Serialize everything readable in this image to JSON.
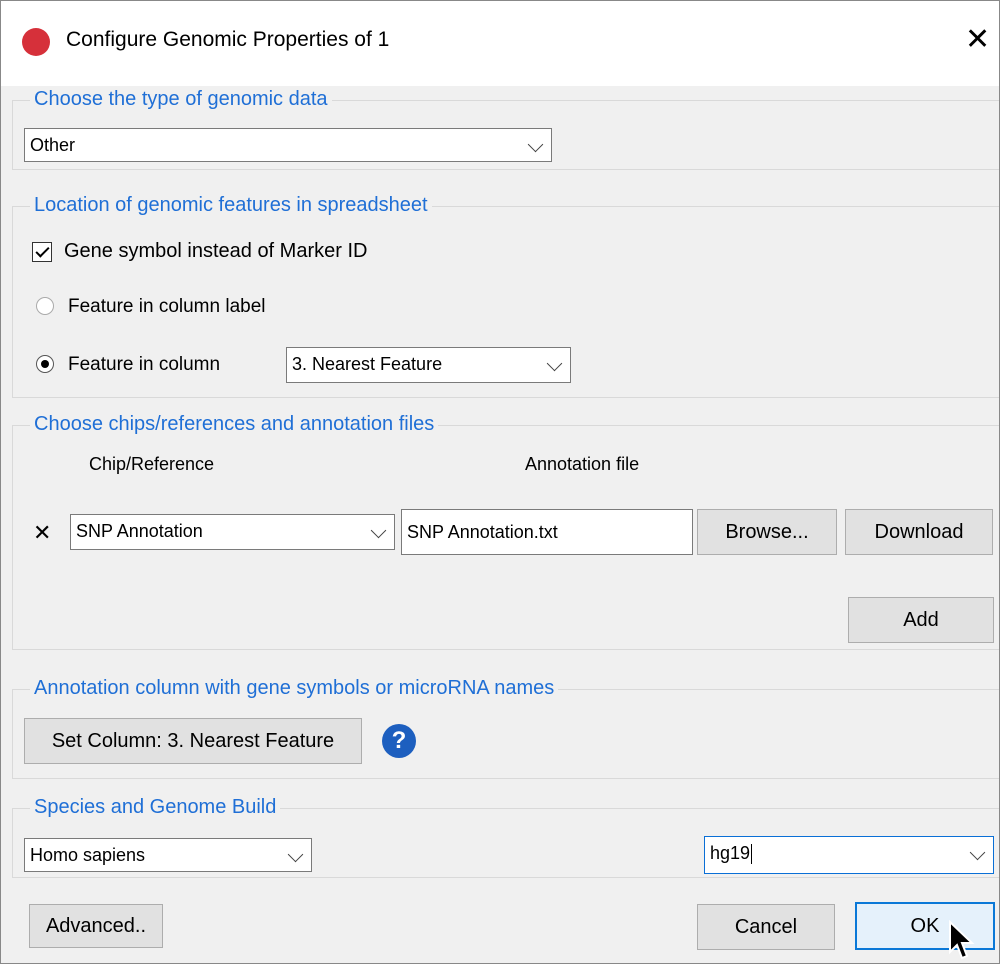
{
  "window": {
    "title": "Configure Genomic Properties of 1",
    "close_glyph": "✕"
  },
  "genomic_type": {
    "legend": "Choose the type of genomic data",
    "selected": "Other"
  },
  "location": {
    "legend": "Location of genomic features in spreadsheet",
    "gene_symbol_label": "Gene symbol instead of Marker ID",
    "gene_symbol_checked": true,
    "feature_label_option": "Feature in column label",
    "feature_column_option": "Feature in column",
    "feature_column_selected": "3. Nearest Feature"
  },
  "chips": {
    "legend": "Choose chips/references and annotation files",
    "col_chip": "Chip/Reference",
    "col_annotation": "Annotation file",
    "remove_glyph": "✕",
    "chip_selected": "SNP Annotation",
    "annotation_file": "SNP Annotation.txt",
    "browse_label": "Browse...",
    "download_label": "Download",
    "add_label": "Add"
  },
  "annotation_column": {
    "legend": "Annotation column with gene symbols or microRNA names",
    "set_column_label": "Set Column: 3. Nearest Feature",
    "help_glyph": "?"
  },
  "species": {
    "legend": "Species and Genome Build",
    "species_selected": "Homo sapiens",
    "build_value": "hg19"
  },
  "footer": {
    "advanced_label": "Advanced..",
    "cancel_label": "Cancel",
    "ok_label": "OK"
  },
  "colors": {
    "legend": "#1f6fd6",
    "app_icon": "#d6303a",
    "help_icon": "#1d5fbf",
    "default_button_border": "#0a78d7"
  }
}
